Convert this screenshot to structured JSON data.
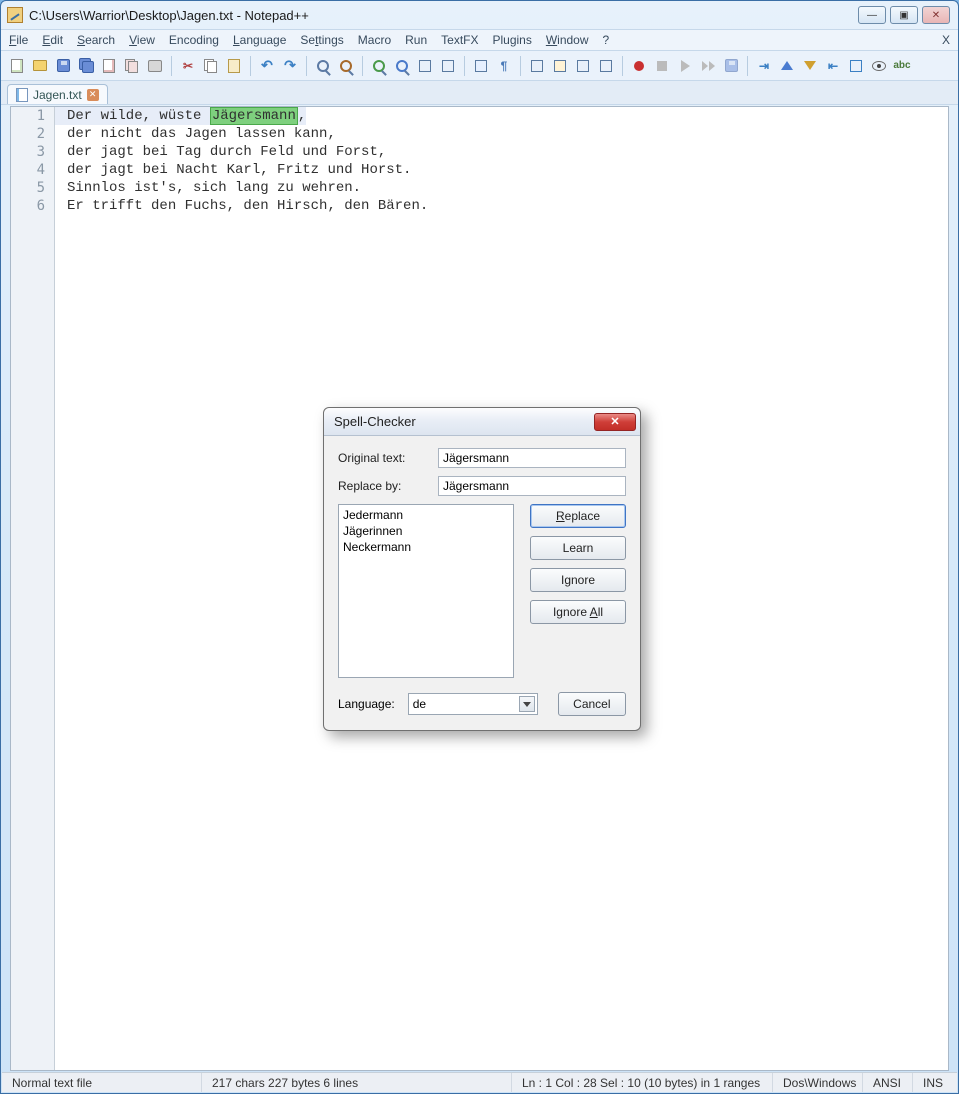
{
  "window": {
    "title": "C:\\Users\\Warrior\\Desktop\\Jagen.txt - Notepad++",
    "controls": {
      "min": "—",
      "max": "▣",
      "close": "✕"
    }
  },
  "menu": {
    "file": "File",
    "edit": "Edit",
    "search": "Search",
    "view": "View",
    "encoding": "Encoding",
    "language": "Language",
    "settings": "Settings",
    "macro": "Macro",
    "run": "Run",
    "textfx": "TextFX",
    "plugins": "Plugins",
    "window": "Window",
    "help": "?",
    "x": "X"
  },
  "tab": {
    "name": "Jagen.txt"
  },
  "editor": {
    "highlighted": "Jägersmann",
    "lines": [
      {
        "n": "1",
        "pre": "Der wilde, wüste ",
        "post": ","
      },
      {
        "n": "2",
        "text": "der nicht das Jagen lassen kann,"
      },
      {
        "n": "3",
        "text": "der jagt bei Tag durch Feld und Forst,"
      },
      {
        "n": "4",
        "text": "der jagt bei Nacht Karl, Fritz und Horst."
      },
      {
        "n": "5",
        "text": "Sinnlos ist's, sich lang zu wehren."
      },
      {
        "n": "6",
        "text": "Er trifft den Fuchs, den Hirsch, den Bären."
      }
    ]
  },
  "dialog": {
    "title": "Spell-Checker",
    "original_label": "Original text:",
    "original_value": "Jägersmann",
    "replace_label": "Replace by:",
    "replace_value": "Jägersmann",
    "suggestions": [
      "Jedermann",
      "Jägerinnen",
      "Neckermann"
    ],
    "buttons": {
      "replace": "Replace",
      "learn": "Learn",
      "ignore": "Ignore",
      "ignore_all": "Ignore All",
      "cancel": "Cancel"
    },
    "language_label": "Language:",
    "language_value": "de"
  },
  "status": {
    "filetype": "Normal text file",
    "stats": "217 chars   227 bytes   6 lines",
    "pos": "Ln : 1    Col : 28    Sel : 10 (10 bytes) in 1 ranges",
    "eol": "Dos\\Windows",
    "enc": "ANSI",
    "ins": "INS"
  }
}
